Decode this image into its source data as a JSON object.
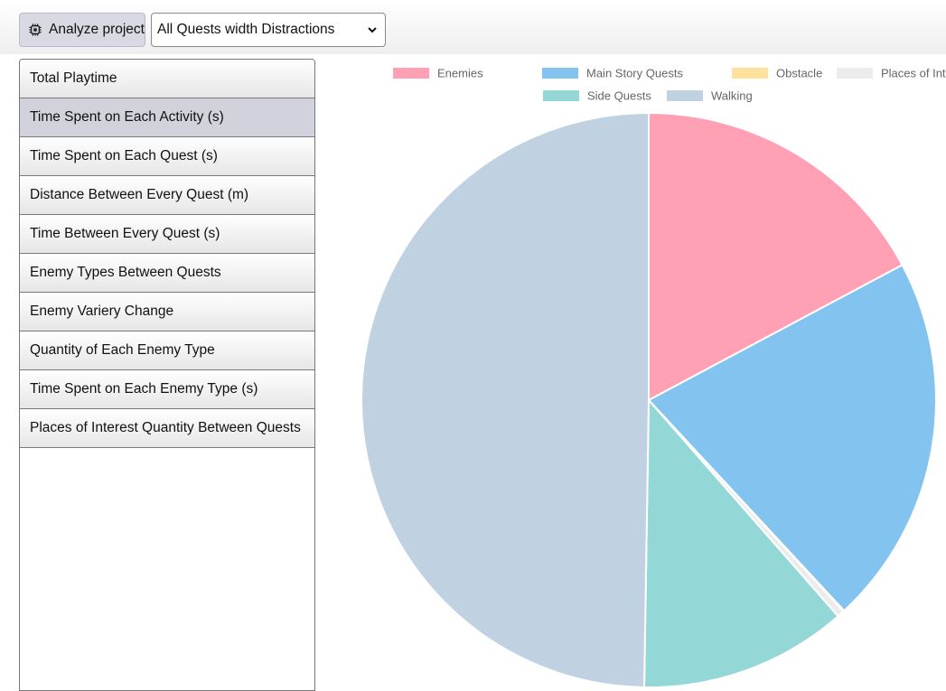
{
  "toolbar": {
    "analyze_label": "Analyze project",
    "analyze_icon": "chip-icon",
    "select_value": "All Quests width Distractions"
  },
  "menu": {
    "items": [
      {
        "label": "Total Playtime"
      },
      {
        "label": "Time Spent on Each Activity (s)"
      },
      {
        "label": "Time Spent on Each Quest (s)"
      },
      {
        "label": "Distance Between Every Quest (m)"
      },
      {
        "label": "Time Between Every Quest (s)"
      },
      {
        "label": "Enemy Types Between Quests"
      },
      {
        "label": "Enemy Variery Change"
      },
      {
        "label": "Quantity of Each Enemy Type"
      },
      {
        "label": "Time Spent on Each Enemy Type (s)"
      },
      {
        "label": "Places of Interest Quantity Between Quests"
      }
    ],
    "active_index": 1
  },
  "chart_data": {
    "type": "pie",
    "title": "",
    "legend_position": "top",
    "slices": [
      {
        "label": "Enemies",
        "value": 17.2,
        "color": "#ffa0b4"
      },
      {
        "label": "Main Story Quests",
        "value": 20.9,
        "color": "#82c3ef"
      },
      {
        "label": "Obstacle",
        "value": 0.05,
        "color": "#ffe19e"
      },
      {
        "label": "Places of Interest",
        "value": 0.4,
        "color": "#ececec"
      },
      {
        "label": "Side Quests",
        "value": 11.7,
        "color": "#93d7d7"
      },
      {
        "label": "Walking",
        "value": 49.75,
        "color": "#c0d2e2"
      }
    ]
  }
}
